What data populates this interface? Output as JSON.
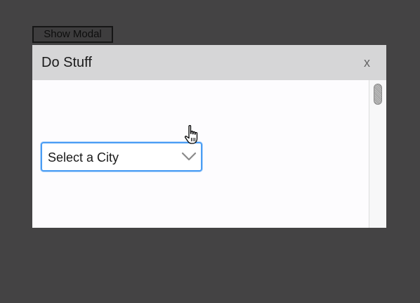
{
  "page": {
    "show_modal_label": "Show Modal"
  },
  "modal": {
    "title": "Do Stuff",
    "close_label": "x",
    "select": {
      "selected": "Select a City"
    }
  },
  "icons": {
    "chevron": "chevron-down-icon",
    "cursor": "hand-pointer-cursor-icon"
  },
  "colors": {
    "background": "#444344",
    "modal_header": "#d6d6d7",
    "focus_border": "#4a9df4"
  }
}
